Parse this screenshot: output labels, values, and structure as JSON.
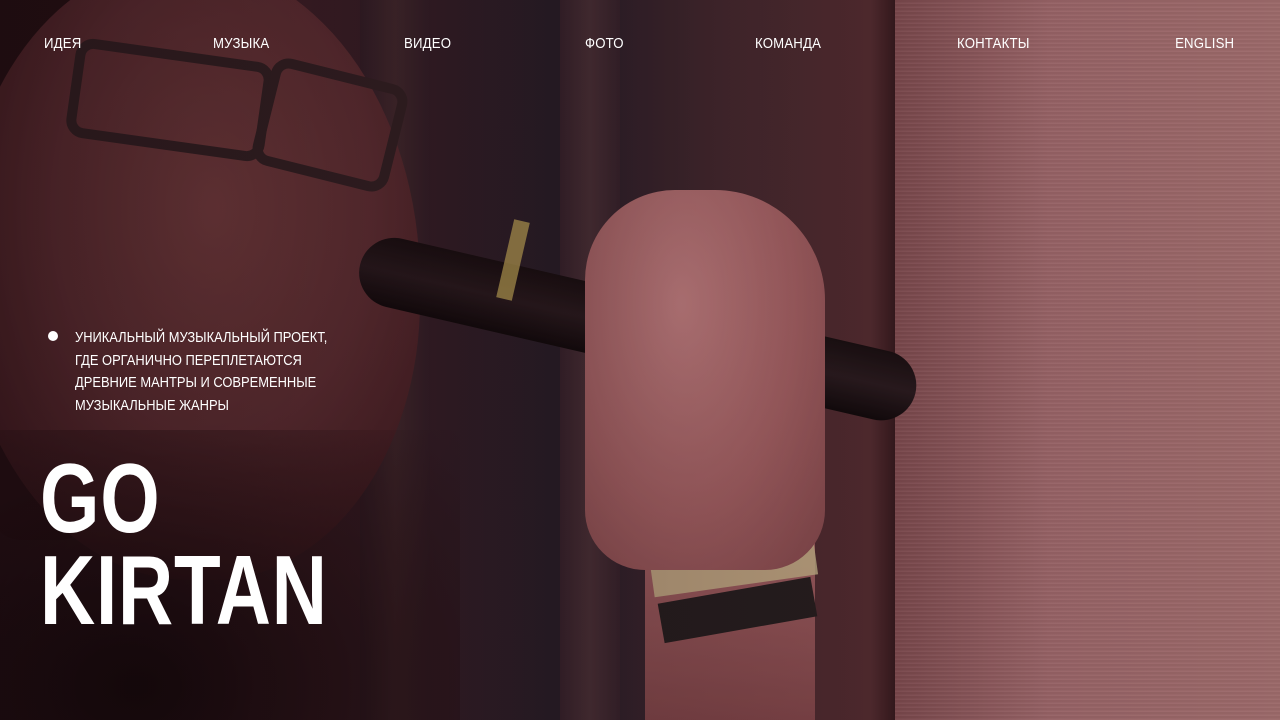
{
  "nav": {
    "items": [
      {
        "label": "ИДЕЯ"
      },
      {
        "label": "МУЗЫКА"
      },
      {
        "label": "ВИДЕО"
      },
      {
        "label": "ФОТО"
      },
      {
        "label": "КОМАНДА"
      },
      {
        "label": "КОНТАКТЫ"
      },
      {
        "label": "ENGLISH"
      }
    ]
  },
  "hero": {
    "tagline": "УНИКАЛЬНЫЙ МУЗЫКАЛЬНЫЙ ПРОЕКТ,\nГДЕ ОРГАНИЧНО ПЕРЕПЛЕТАЮТСЯ\nДРЕВНИЕ МАНТРЫ И СОВРЕМЕННЫЕ\nМУЗЫКАЛЬНЫЕ ЖАНРЫ",
    "title_line_1": "GO",
    "title_line_2": "KIRTAN"
  },
  "colors": {
    "text": "#ffffff",
    "overlay_tint": "#78283c"
  }
}
